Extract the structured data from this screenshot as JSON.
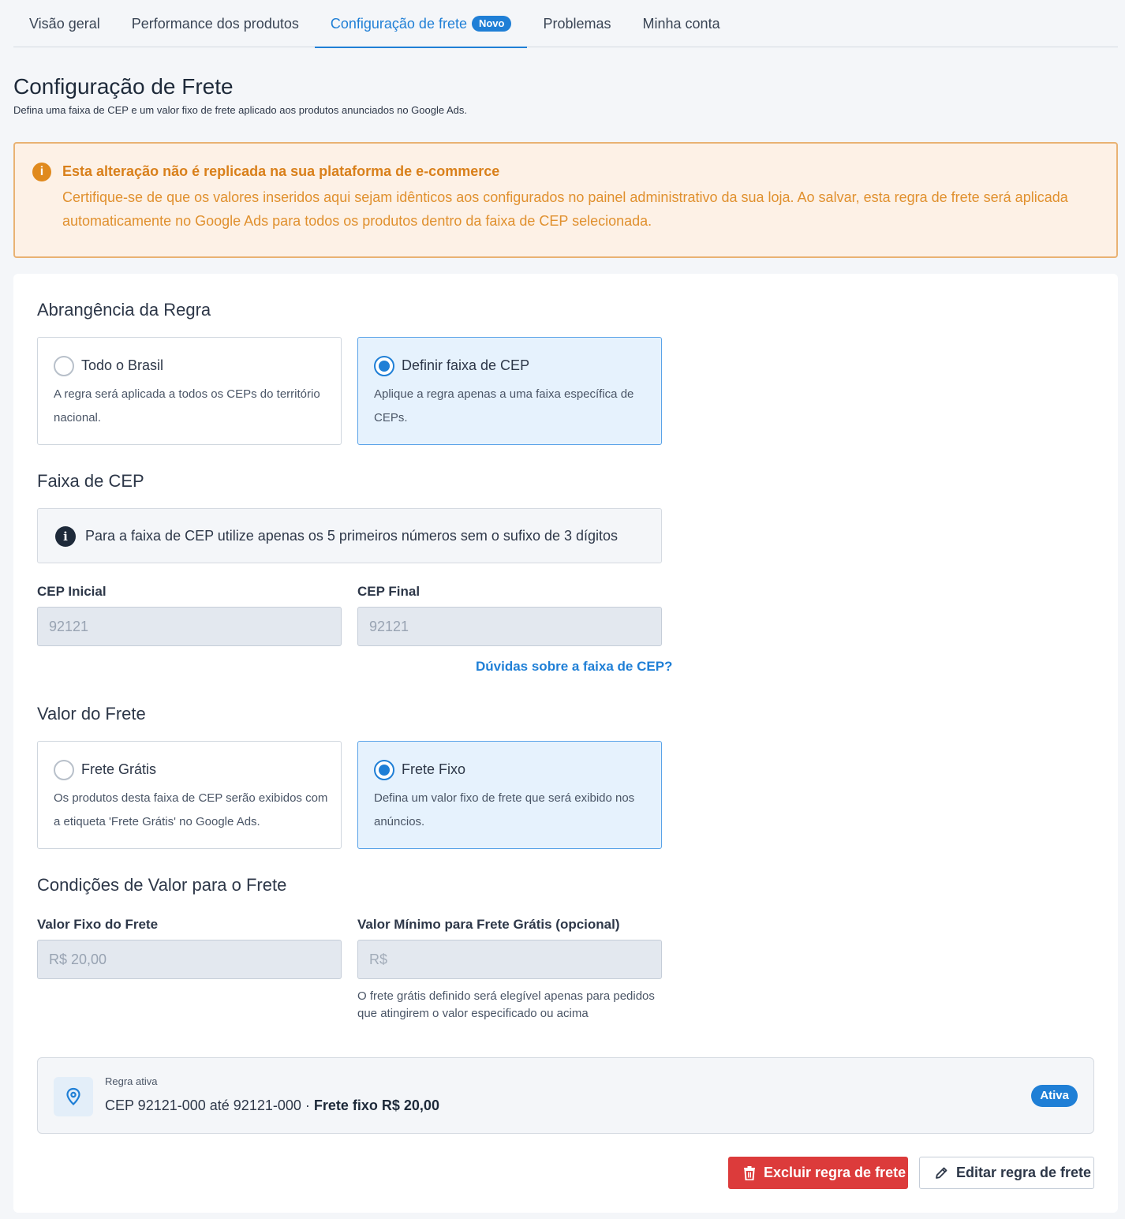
{
  "tabs": [
    {
      "label": "Visão geral"
    },
    {
      "label": "Performance dos produtos"
    },
    {
      "label": "Configuração de frete",
      "badge": "Novo"
    },
    {
      "label": "Problemas"
    },
    {
      "label": "Minha conta"
    }
  ],
  "page": {
    "title": "Configuração de Frete",
    "subtitle": "Defina uma faixa de CEP e um valor fixo de frete aplicado aos produtos anunciados no Google Ads."
  },
  "warning": {
    "title": "Esta alteração não é replicada na sua plataforma de e-commerce",
    "text": "Certifique-se de que os valores inseridos aqui sejam idênticos aos configurados no painel administrativo da sua loja. Ao salvar, esta regra de frete será aplicada automaticamente no Google Ads para todos os produtos dentro da faixa de CEP selecionada."
  },
  "scope": {
    "title": "Abrangência da Regra",
    "options": [
      {
        "label": "Todo o Brasil",
        "desc": "A regra será aplicada a todos os CEPs do território nacional.",
        "selected": false
      },
      {
        "label": "Definir faixa de CEP",
        "desc": "Aplique a regra apenas a uma faixa específica de CEPs.",
        "selected": true
      }
    ]
  },
  "cep": {
    "title": "Faixa de CEP",
    "info": "Para a faixa de CEP utilize apenas os 5 primeiros números sem o sufixo de 3 dígitos",
    "start_label": "CEP Inicial",
    "start_value": "92121",
    "end_label": "CEP Final",
    "end_value": "92121",
    "help_link": "Dúvidas sobre a faixa de CEP?"
  },
  "freight": {
    "title": "Valor do Frete",
    "options": [
      {
        "label": "Frete Grátis",
        "desc": "Os produtos desta faixa de CEP serão exibidos com a etiqueta 'Frete Grátis' no Google Ads.",
        "selected": false
      },
      {
        "label": "Frete Fixo",
        "desc": "Defina um valor fixo de frete que será exibido nos anúncios.",
        "selected": true
      }
    ]
  },
  "conditions": {
    "title": "Condições de Valor para o Frete",
    "fixed_label": "Valor Fixo do Frete",
    "fixed_value": "R$ 20,00",
    "min_label": "Valor Mínimo para Frete Grátis (opcional)",
    "min_placeholder": "R$",
    "min_helper": "O frete grátis definido será elegível apenas para pedidos que atingirem o valor especificado ou acima"
  },
  "active_rule": {
    "caption": "Regra ativa",
    "range": "CEP 92121-000 até 92121-000 · ",
    "price": "Frete fixo R$ 20,00",
    "status": "Ativa"
  },
  "actions": {
    "delete_label": "Excluir regra de frete",
    "edit_label": "Editar regra de frete"
  },
  "colors": {
    "accent": "#1f7fd6",
    "warning": "#e08a1e",
    "danger": "#dc3b3b"
  }
}
